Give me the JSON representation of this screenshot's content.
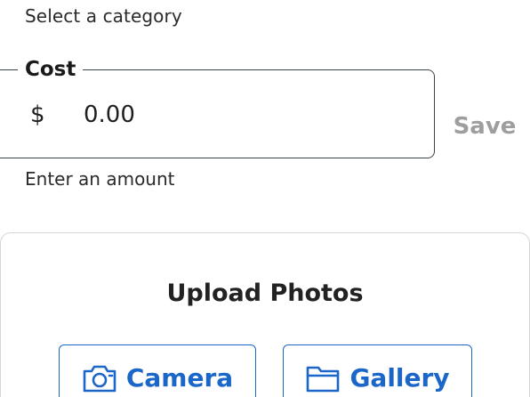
{
  "category": {
    "helper": "Select a category"
  },
  "cost": {
    "label": "Cost",
    "currency_symbol": "$",
    "placeholder": "0.00",
    "helper": "Enter an amount"
  },
  "actions": {
    "save_label": "Save"
  },
  "upload": {
    "title": "Upload Photos",
    "camera_label": "Camera",
    "camera_icon": "camera-icon",
    "gallery_label": "Gallery",
    "gallery_icon": "folder-icon"
  },
  "colors": {
    "accent": "#1a66c9",
    "disabled_text": "#9e9e9e",
    "field_border": "#3a4450",
    "card_border": "#d6d6d6"
  }
}
